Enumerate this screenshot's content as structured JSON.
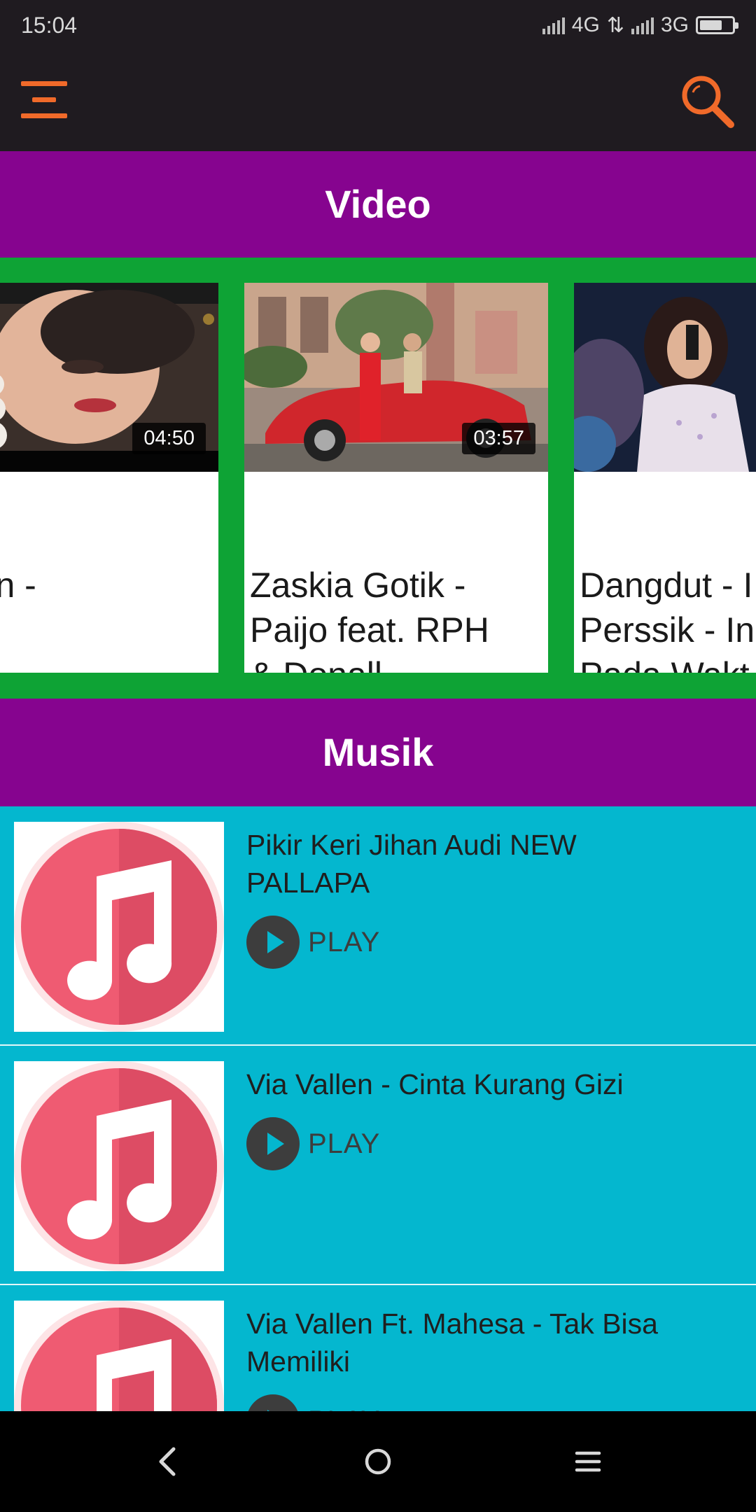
{
  "status_bar": {
    "time": "15:04",
    "network_1": "4G",
    "network_2": "3G",
    "battery_level": 0.7
  },
  "colors": {
    "accent": "#f06a2a",
    "section_header": "#86048f",
    "video_strip": "#0ea335",
    "music_bg": "#04b7cf"
  },
  "sections": {
    "video_label": "Video",
    "music_label": "Musik"
  },
  "videos": [
    {
      "duration": "04:50",
      "title": "Vallen -\nka"
    },
    {
      "duration": "03:57",
      "title": "Zaskia Gotik -\nPaijo feat. RPH\n& Donall"
    },
    {
      "duration": "",
      "title": "Dangdut - I\nPerssik - In\nPada Wakt"
    }
  ],
  "songs": [
    {
      "title": "Pikir Keri   Jihan Audi NEW PALLAPA",
      "play_label": "PLAY"
    },
    {
      "title": "Via Vallen - Cinta Kurang Gizi",
      "play_label": "PLAY"
    },
    {
      "title": "Via Vallen Ft. Mahesa - Tak Bisa Memiliki",
      "play_label": "PLAY"
    }
  ],
  "icons": {
    "menu": "menu-icon",
    "search": "search-icon",
    "music_note": "music-note-icon",
    "back": "back-icon",
    "home": "home-icon",
    "recents": "recents-icon"
  }
}
